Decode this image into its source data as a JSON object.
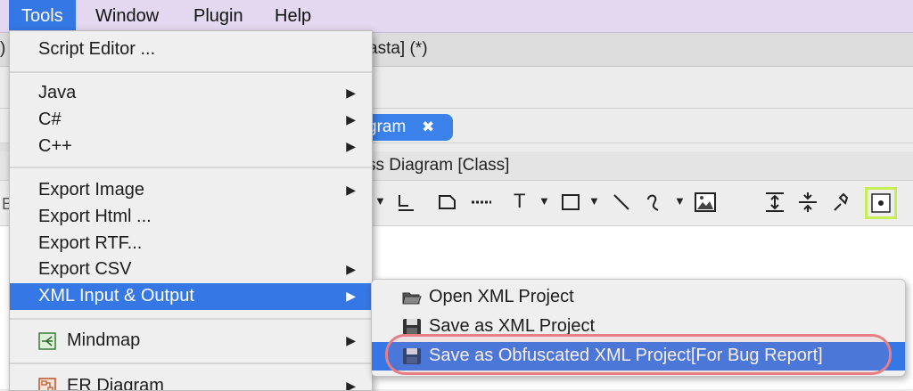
{
  "menubar": {
    "items": [
      {
        "label": "Tools",
        "active": true
      },
      {
        "label": "Window"
      },
      {
        "label": "Plugin"
      },
      {
        "label": "Help"
      }
    ]
  },
  "background": {
    "window_title_fragment": "asta] (*)",
    "tab_label": "gram",
    "tab_close": "✖",
    "diagram_title": "ss Diagram [Class]",
    "left_edge_glyph": ")",
    "left_edge_glyph2": "E"
  },
  "tools_menu": {
    "items": [
      {
        "label": "Script Editor ...",
        "has_submenu": false
      },
      {
        "label": "Java",
        "has_submenu": true
      },
      {
        "label": "C#",
        "has_submenu": true
      },
      {
        "label": "C++",
        "has_submenu": true
      },
      {
        "label": "Export Image",
        "has_submenu": true
      },
      {
        "label": "Export Html ...",
        "has_submenu": false
      },
      {
        "label": "Export RTF...",
        "has_submenu": false
      },
      {
        "label": "Export CSV",
        "has_submenu": true
      },
      {
        "label": "XML Input & Output",
        "has_submenu": true,
        "selected": true
      },
      {
        "label": "Mindmap",
        "has_submenu": true,
        "icon": "mindmap-icon"
      },
      {
        "label": "ER Diagram",
        "has_submenu": true,
        "icon": "er-diagram-icon"
      }
    ]
  },
  "xml_submenu": {
    "items": [
      {
        "label": "Open XML Project",
        "icon": "open-folder-icon"
      },
      {
        "label": "Save as XML Project",
        "icon": "floppy-disk-icon"
      },
      {
        "label": "Save as Obfuscated XML Project[For Bug Report]",
        "icon": "floppy-disk-icon",
        "selected": true
      }
    ]
  },
  "colors": {
    "menubar_bg": "#e3d8ef",
    "selection": "#3577e4",
    "highlight_ring": "#e87d85",
    "focus_box": "#c7ee55"
  }
}
